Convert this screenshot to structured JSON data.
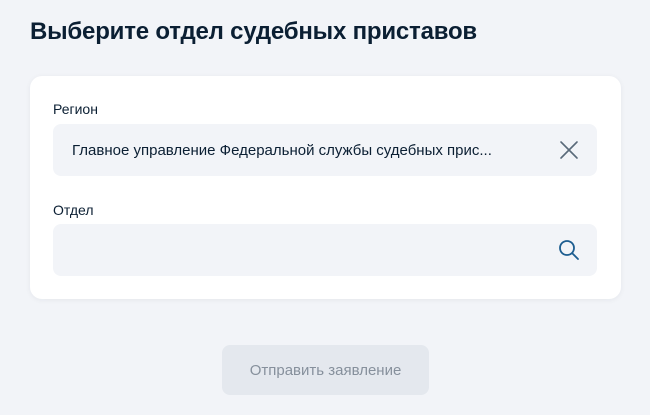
{
  "page": {
    "title": "Выберите отдел судебных приставов"
  },
  "form": {
    "region": {
      "label": "Регион",
      "value": "Главное управление Федеральной службы судебных прис...",
      "action_icon": "close-icon"
    },
    "department": {
      "label": "Отдел",
      "value": "",
      "placeholder": "",
      "action_icon": "search-icon"
    }
  },
  "actions": {
    "submit_label": "Отправить заявление",
    "submit_disabled": true
  },
  "colors": {
    "background": "#f2f4f8",
    "card": "#ffffff",
    "field": "#f2f4f8",
    "text": "#0b1f33",
    "icon": "#0b1f33",
    "search_icon": "#1d5d90",
    "disabled_button_bg": "#e4e8ee",
    "disabled_button_text": "#86909c"
  }
}
